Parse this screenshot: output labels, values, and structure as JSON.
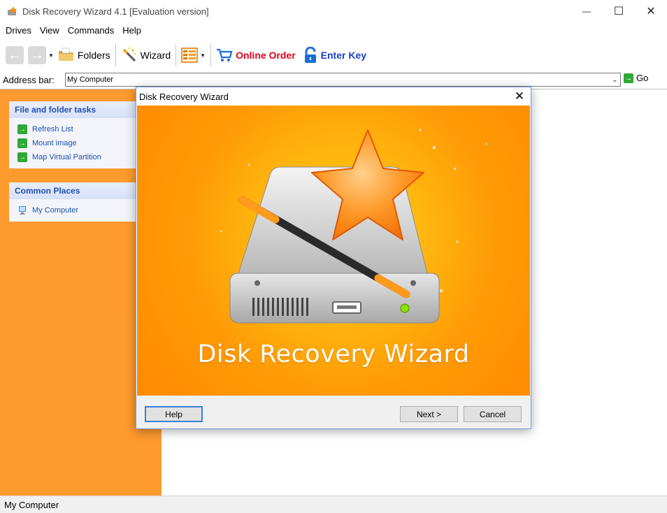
{
  "window": {
    "title": "Disk Recovery Wizard 4.1 [Evaluation version]",
    "controls": {
      "minimize": "—",
      "maximize": "☐",
      "close": "✕"
    }
  },
  "menu": [
    {
      "label": "Drives"
    },
    {
      "label": "View"
    },
    {
      "label": "Commands"
    },
    {
      "label": "Help"
    }
  ],
  "toolbar": {
    "folders_label": "Folders",
    "wizard_label": "Wizard",
    "online_order_label": "Online Order",
    "enter_key_label": "Enter Key",
    "colors": {
      "online_order": "#e3001b",
      "enter_key": "#1a3fc7"
    }
  },
  "address_bar": {
    "label": "Address bar:",
    "value": "My Computer",
    "go_label": "Go"
  },
  "sidebar": {
    "file_tasks": {
      "header": "File and folder tasks",
      "items": [
        {
          "label": "Refresh List",
          "icon": "green-arrow-icon"
        },
        {
          "label": "Mount image",
          "icon": "green-arrow-icon"
        },
        {
          "label": "Map Virtual Partition",
          "icon": "green-arrow-icon"
        }
      ]
    },
    "common_places": {
      "header": "Common Places",
      "items": [
        {
          "label": "My Computer",
          "icon": "computer-icon"
        }
      ]
    },
    "color": "#ff9a2e"
  },
  "dialog": {
    "title": "Disk Recovery Wizard",
    "banner_title": "Disk Recovery Wizard",
    "buttons": {
      "help": "Help",
      "next": "Next >",
      "cancel": "Cancel"
    }
  },
  "status_bar": {
    "text": "My Computer"
  }
}
